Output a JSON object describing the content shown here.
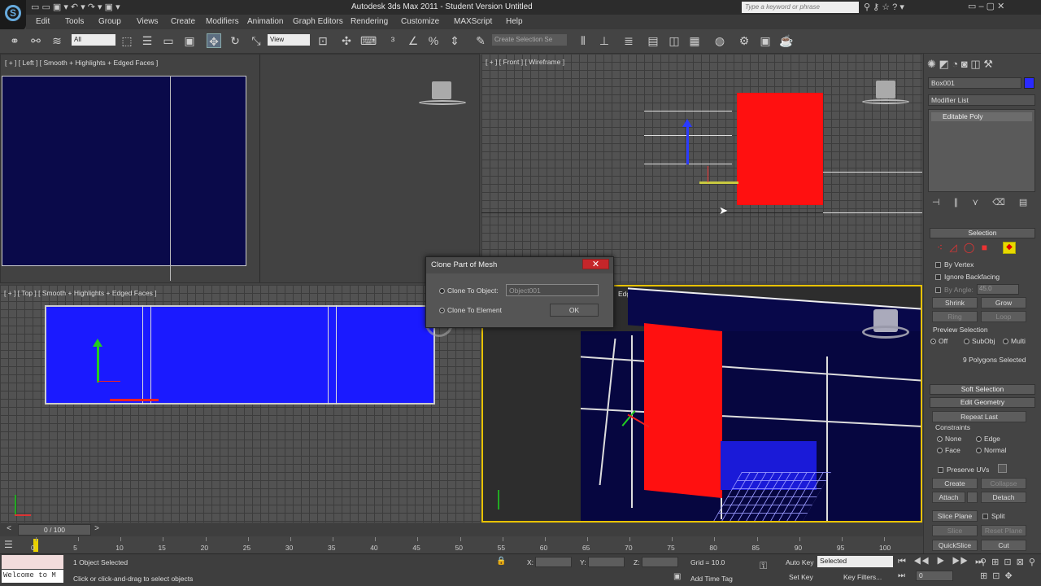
{
  "app": {
    "title": "Autodesk 3ds Max  2011    -  Student Version    Untitled",
    "search_placeholder": "Type a keyword or phrase"
  },
  "menu": [
    "Edit",
    "Tools",
    "Group",
    "Views",
    "Create",
    "Modifiers",
    "Animation",
    "Graph Editors",
    "Rendering",
    "Customize",
    "MAXScript",
    "Help"
  ],
  "toolbar": {
    "filter_value": "All",
    "refcoord_value": "View",
    "named_selection_placeholder": "Create Selection Se"
  },
  "viewports": {
    "left": "[ + ] [ Left ] [ Smooth + Highlights + Edged Faces ]",
    "front": "[ + ] [ Front ] [ Wireframe ]",
    "top": "[ + ] [ Top ] [ Smooth + Highlights + Edged Faces ]",
    "persp_fragment": "Edged Faces ]"
  },
  "dialog": {
    "title": "Clone Part of Mesh",
    "close": "✕",
    "opt_object": "Clone To Object:",
    "object_name": "Object001",
    "opt_element": "Clone To Element",
    "ok": "OK"
  },
  "panel": {
    "object_name": "Box001",
    "modifier_list": "Modifier List",
    "stack_item": "Editable Poly",
    "selection": {
      "header": "Selection",
      "by_vertex": "By Vertex",
      "ignore_backfacing": "Ignore Backfacing",
      "by_angle": "By Angle:",
      "angle_value": "45.0",
      "shrink": "Shrink",
      "grow": "Grow",
      "ring": "Ring",
      "loop": "Loop",
      "preview_label": "Preview Selection",
      "off": "Off",
      "subobj": "SubObj",
      "multi": "Multi",
      "status": "9 Polygons Selected"
    },
    "soft_selection": "Soft Selection",
    "edit_geometry": {
      "header": "Edit Geometry",
      "repeat_last": "Repeat Last",
      "constraints": "Constraints",
      "none": "None",
      "edge": "Edge",
      "face": "Face",
      "normal": "Normal",
      "preserve_uvs": "Preserve UVs",
      "create": "Create",
      "collapse": "Collapse",
      "attach": "Attach",
      "detach": "Detach",
      "slice_plane": "Slice Plane",
      "split": "Split",
      "slice": "Slice",
      "reset_plane": "Reset Plane",
      "quickslice": "QuickSlice",
      "cut": "Cut"
    },
    "accent_color": "#2a2aff"
  },
  "timeline": {
    "frame": "0 / 100",
    "ticks": [
      "0",
      "5",
      "10",
      "15",
      "20",
      "25",
      "30",
      "35",
      "40",
      "45",
      "50",
      "55",
      "60",
      "65",
      "70",
      "75",
      "80",
      "85",
      "90",
      "95",
      "100"
    ]
  },
  "status": {
    "maxscript": "Welcome to M",
    "selected": "1 Object Selected",
    "prompt": "Click or click-and-drag to select objects",
    "x": "X:",
    "y": "Y:",
    "z": "Z:",
    "grid": "Grid = 10.0",
    "add_time_tag": "Add Time Tag",
    "auto_key": "Auto Key",
    "set_key": "Set Key",
    "selected_dropdown": "Selected",
    "key_filters": "Key Filters...",
    "frame_value": "0"
  }
}
